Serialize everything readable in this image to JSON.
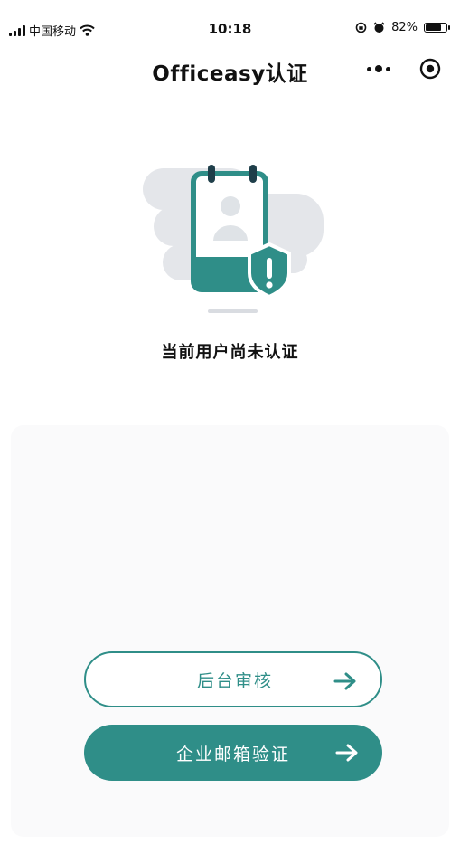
{
  "status_bar": {
    "carrier": "中国移动",
    "time": "10:18",
    "battery_percent": "82%",
    "battery_level": 0.82,
    "icons": [
      "signal-icon",
      "wifi-icon",
      "rotation-lock-icon",
      "alarm-icon",
      "battery-icon"
    ]
  },
  "nav": {
    "title": "Officeasy认证",
    "more_icon": "more-dots-icon",
    "close_icon": "target-icon"
  },
  "main": {
    "illustration_icon": "id-card-warning-illustration",
    "status_text": "当前用户尚未认证"
  },
  "actions": {
    "backend_review_label": "后台审核",
    "email_verify_label": "企业邮箱验证",
    "arrow_icon": "arrow-right-icon"
  },
  "colors": {
    "accent": "#2f8e88",
    "accent_dark": "#1f6f6b",
    "cloud": "#e4e6ea"
  }
}
